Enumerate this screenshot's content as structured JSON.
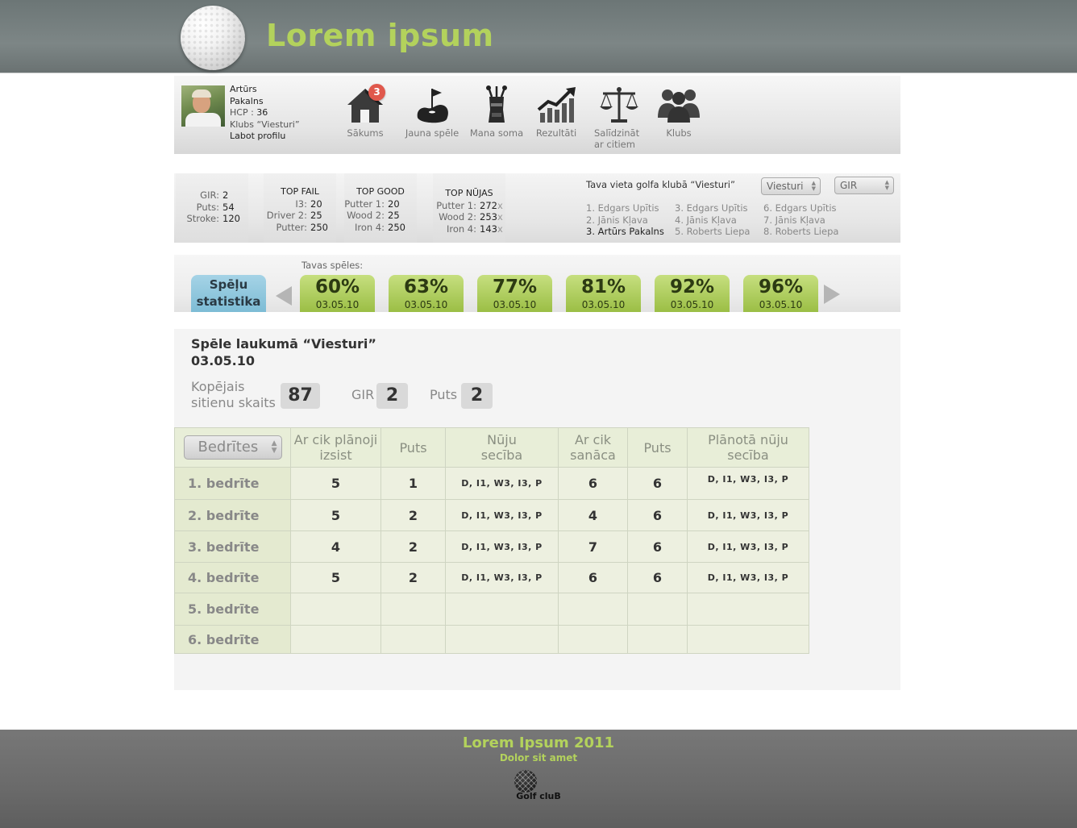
{
  "header": {
    "title": "Lorem ipsum"
  },
  "profile": {
    "first_name": "Artūrs",
    "last_name": "Pakalns",
    "hcp_label": "HCP :",
    "hcp_value": "36",
    "club": "Klubs “Viesturi”",
    "edit_link": "Labot profilu"
  },
  "nav": {
    "home": "Sākums",
    "home_badge": "3",
    "new_game": "Jauna spēle",
    "my_bag": "Mana soma",
    "results": "Rezultāti",
    "compare_1": "Salīdzināt",
    "compare_2": "ar citiem",
    "clubs": "Klubs"
  },
  "stats": {
    "basic": [
      {
        "k": "GIR:",
        "v": "2"
      },
      {
        "k": "Puts:",
        "v": "54"
      },
      {
        "k": "Stroke:",
        "v": "120"
      }
    ],
    "top_fail": {
      "title": "TOP FAIL",
      "rows": [
        {
          "k": "I3:",
          "v": "20"
        },
        {
          "k": "Driver 2:",
          "v": "25"
        },
        {
          "k": "Putter:",
          "v": "250"
        }
      ]
    },
    "top_good": {
      "title": "TOP GOOD",
      "rows": [
        {
          "k": "Putter 1:",
          "v": "20"
        },
        {
          "k": "Wood 2:",
          "v": "25"
        },
        {
          "k": "Iron 4:",
          "v": "250"
        }
      ]
    },
    "top_nujas": {
      "title": "TOP NŪJAS",
      "rows": [
        {
          "k": "Putter 1:",
          "v": "272",
          "x": "x"
        },
        {
          "k": "Wood 2:",
          "v": "253",
          "x": "x"
        },
        {
          "k": "Iron 4:",
          "v": "143",
          "x": "x"
        }
      ]
    }
  },
  "ranking": {
    "title": "Tava vieta golfa klubā “Viesturi”",
    "club_select": "Viesturi",
    "metric_select": "GIR",
    "col1": [
      "1. Edgars Upītis",
      "2. Jānis Kļava",
      "3. Artūrs Pakalns"
    ],
    "col2": [
      "3. Edgars Upītis",
      "4. Jānis Kļava",
      "5. Roberts Liepa"
    ],
    "col3": [
      "6. Edgars Upītis",
      "7. Jānis Kļava",
      "8. Roberts Liepa"
    ]
  },
  "games": {
    "label": "Tavas spēles:",
    "stats_tab_1": "Spēļu",
    "stats_tab_2": "statistika",
    "items": [
      {
        "pct": "60%",
        "date": "03.05.10"
      },
      {
        "pct": "63%",
        "date": "03.05.10"
      },
      {
        "pct": "77%",
        "date": "03.05.10"
      },
      {
        "pct": "81%",
        "date": "03.05.10"
      },
      {
        "pct": "92%",
        "date": "03.05.10"
      },
      {
        "pct": "96%",
        "date": "03.05.10"
      }
    ]
  },
  "game": {
    "course": "Spēle laukumā “Viesturi”",
    "date": "03.05.10",
    "total_label_1": "Kopējais",
    "total_label_2": "sitienu skaits",
    "total_value": "87",
    "gir_label": "GIR",
    "gir_value": "2",
    "puts_label": "Puts",
    "puts_value": "2"
  },
  "table": {
    "select_label": "Bedrītes",
    "headers": {
      "planned_1": "Ar cik plānoji",
      "planned_2": "izsist",
      "puts": "Puts",
      "seq_1": "Nūju",
      "seq_2": "secība",
      "actual_1": "Ar cik",
      "actual_2": "sanāca",
      "puts2": "Puts",
      "plan_seq_1": "Plānotā nūju",
      "plan_seq_2": "secība"
    },
    "rows": [
      {
        "hole": "1. bedrīte",
        "planned": "5",
        "puts": "1",
        "seq": "D, I1, W3, I3, P",
        "actual": "6",
        "puts2": "6",
        "plan_seq": "D, I1, W3, I3, P"
      },
      {
        "hole": "2. bedrīte",
        "planned": "5",
        "puts": "2",
        "seq": "D, I1, W3, I3, P",
        "actual": "4",
        "puts2": "6",
        "plan_seq": "D, I1, W3, I3, P"
      },
      {
        "hole": "3. bedrīte",
        "planned": "4",
        "puts": "2",
        "seq": "D, I1, W3, I3, P",
        "actual": "7",
        "puts2": "6",
        "plan_seq": "D, I1, W3, I3, P"
      },
      {
        "hole": "4. bedrīte",
        "planned": "5",
        "puts": "2",
        "seq": "D, I1, W3, I3, P",
        "actual": "6",
        "puts2": "6",
        "plan_seq": "D, I1, W3, I3, P"
      },
      {
        "hole": "5. bedrīte",
        "planned": "",
        "puts": "",
        "seq": "",
        "actual": "",
        "puts2": "",
        "plan_seq": ""
      },
      {
        "hole": "6. bedrīte",
        "planned": "",
        "puts": "",
        "seq": "",
        "actual": "",
        "puts2": "",
        "plan_seq": ""
      }
    ]
  },
  "footer": {
    "title": "Lorem Ipsum 2011",
    "subtitle": "Dolor sit amet",
    "logo_text": "Golf cluB"
  },
  "colors": {
    "accent_green": "#b3d25c",
    "tab_green": "#9bbe45",
    "tab_blue": "#7dbcd5",
    "badge_red": "#e0584c"
  }
}
